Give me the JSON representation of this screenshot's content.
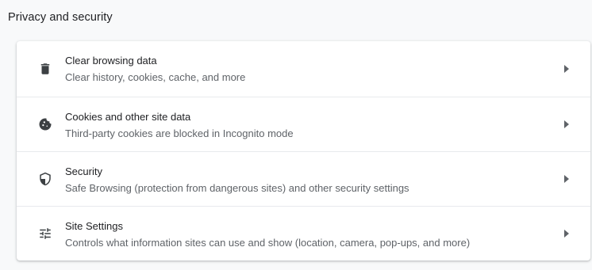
{
  "section": {
    "title": "Privacy and security"
  },
  "items": [
    {
      "icon": "trash-icon",
      "title": "Clear browsing data",
      "subtitle": "Clear history, cookies, cache, and more"
    },
    {
      "icon": "cookie-icon",
      "title": "Cookies and other site data",
      "subtitle": "Third-party cookies are blocked in Incognito mode"
    },
    {
      "icon": "shield-icon",
      "title": "Security",
      "subtitle": "Safe Browsing (protection from dangerous sites) and other security settings"
    },
    {
      "icon": "tune-icon",
      "title": "Site Settings",
      "subtitle": "Controls what information sites can use and show (location, camera, pop-ups, and more)"
    }
  ],
  "colors": {
    "background": "#f8f9fa",
    "card": "#ffffff",
    "primary_text": "#202124",
    "secondary_text": "#5f6368",
    "divider": "#e8eaed"
  }
}
